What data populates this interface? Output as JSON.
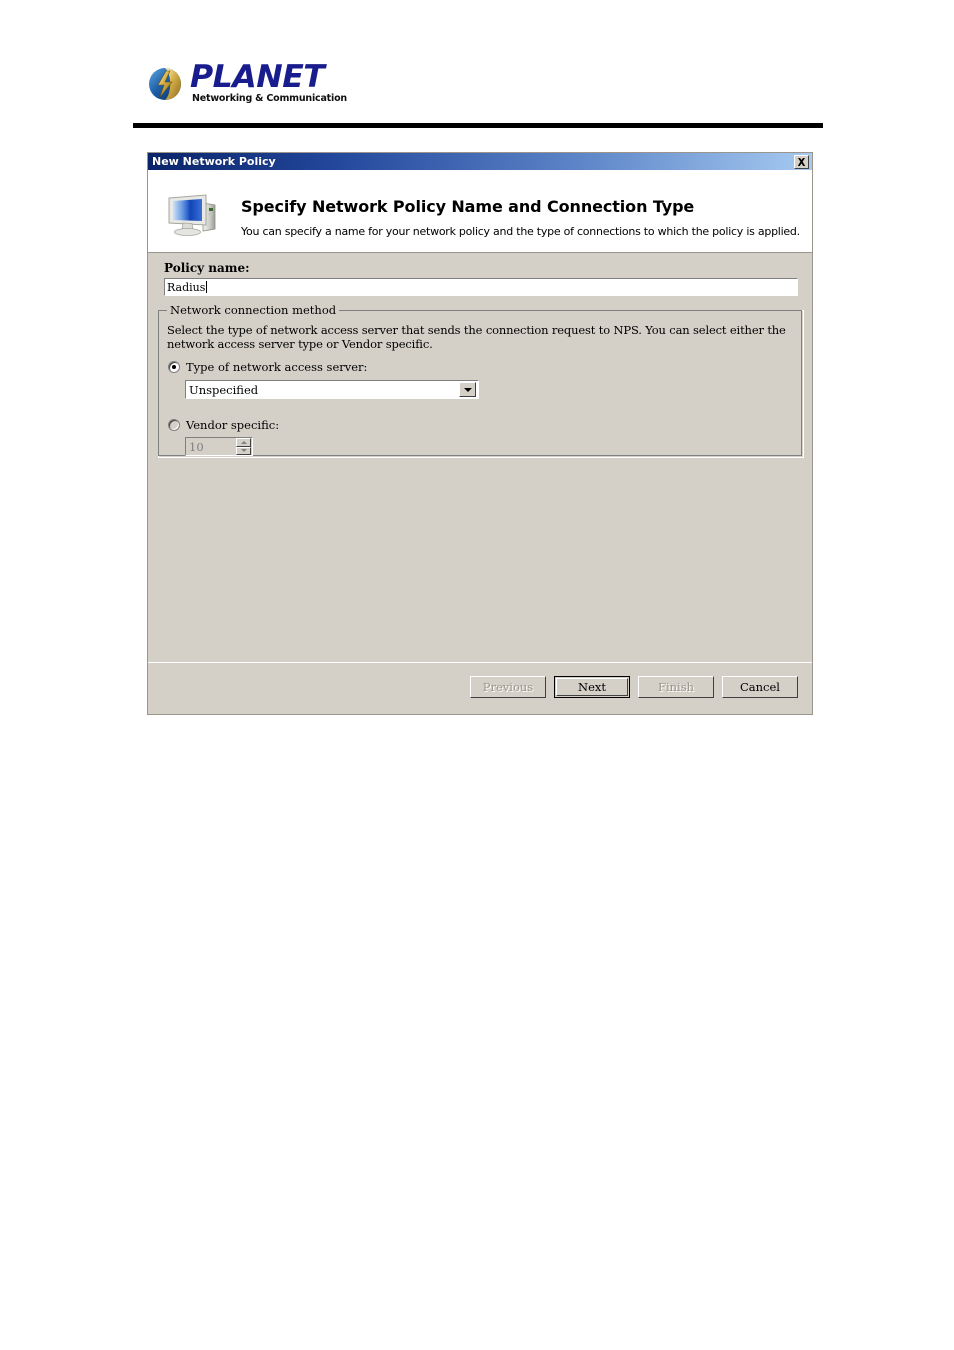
{
  "page": {
    "logo": {
      "wordmark": "PLANET",
      "tagline": "Networking & Communication",
      "mark_icon": "planet-globe-icon"
    }
  },
  "dialog": {
    "titlebar": {
      "title": "New Network Policy",
      "close_icon": "close-icon"
    },
    "header": {
      "icon": "computer-monitor-icon",
      "title": "Specify Network Policy Name and Connection Type",
      "subtitle": "You can specify a name for your network policy and the type of connections to which the policy is applied."
    },
    "policy_name": {
      "label": "Policy name:",
      "value": "Radius"
    },
    "network_connection_method": {
      "legend": "Network connection method",
      "description": "Select the type of network access server that sends the connection request to NPS. You can select either the network access server type or Vendor specific.",
      "option_server_type": {
        "label": "Type of network access server:",
        "selected": true,
        "dropdown": {
          "value": "Unspecified",
          "arrow_icon": "chevron-down-icon"
        }
      },
      "option_vendor_specific": {
        "label": "Vendor specific:",
        "selected": false,
        "spinner": {
          "value": "10",
          "up_icon": "arrow-up-icon",
          "down_icon": "arrow-down-icon",
          "disabled": true
        }
      }
    },
    "footer": {
      "buttons": [
        {
          "label": "Previous",
          "state": "disabled"
        },
        {
          "label": "Next",
          "state": "default"
        },
        {
          "label": "Finish",
          "state": "disabled"
        },
        {
          "label": "Cancel",
          "state": "enabled"
        }
      ]
    }
  },
  "colors": {
    "title_start": "#0a246a",
    "title_end": "#a6caf0",
    "dialog_face": "#d4d0c8",
    "logo_blue": "#181c8c"
  }
}
